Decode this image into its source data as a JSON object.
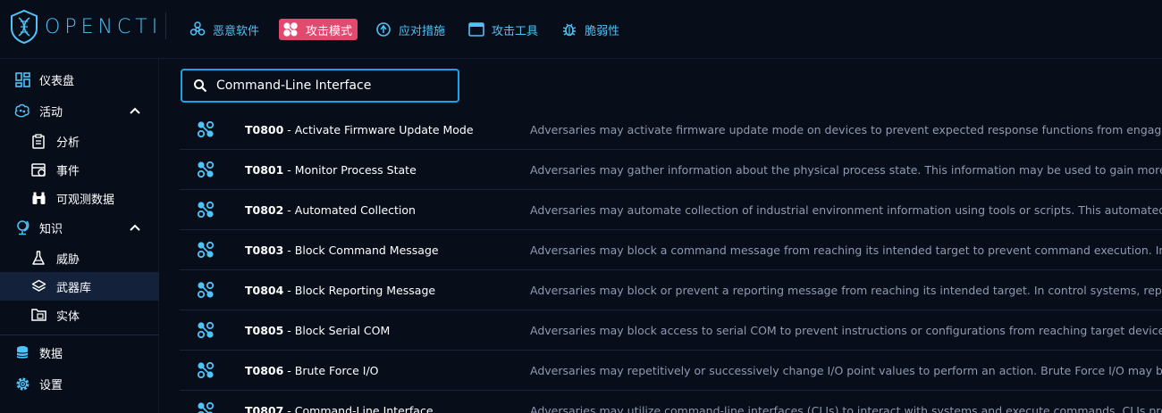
{
  "app": {
    "logo_text": "OPENCTI"
  },
  "topnav": [
    {
      "label": "恶意软件",
      "icon": "biohazard-icon",
      "active": false
    },
    {
      "label": "攻击模式",
      "icon": "attack-pattern-icon",
      "active": true
    },
    {
      "label": "应对措施",
      "icon": "course-of-action-icon",
      "active": false
    },
    {
      "label": "攻击工具",
      "icon": "tool-window-icon",
      "active": false
    },
    {
      "label": "脆弱性",
      "icon": "bug-icon",
      "active": false
    }
  ],
  "sidebar": {
    "dashboard": "仪表盘",
    "activities": "活动",
    "analysis": "分析",
    "events": "事件",
    "observations": "可观测数据",
    "knowledge": "知识",
    "threats": "威胁",
    "arsenal": "武器库",
    "entities": "实体",
    "data": "数据",
    "settings": "设置"
  },
  "search": {
    "value": "Command-Line Interface"
  },
  "rows": [
    {
      "id": "T0800",
      "name": " - Activate Firmware Update Mode",
      "desc": "Adversaries may activate firmware update mode on devices to prevent expected response functions from engaging in reac"
    },
    {
      "id": "T0801",
      "name": " - Monitor Process State",
      "desc": "Adversaries may gather information about the physical process state. This information may be used to gain more informat"
    },
    {
      "id": "T0802",
      "name": " - Automated Collection",
      "desc": "Adversaries may automate collection of industrial environment information using tools or scripts. This automated collectio"
    },
    {
      "id": "T0803",
      "name": " - Block Command Message",
      "desc": "Adversaries may block a command message from reaching its intended target to prevent command execution. In OT netw"
    },
    {
      "id": "T0804",
      "name": " - Block Reporting Message",
      "desc": "Adversaries may block or prevent a reporting message from reaching its intended target. In control systems, reporting me"
    },
    {
      "id": "T0805",
      "name": " - Block Serial COM",
      "desc": "Adversaries may block access to serial COM to prevent instructions or configurations from reaching target devices. Serial C"
    },
    {
      "id": "T0806",
      "name": " - Brute Force I/O",
      "desc": "Adversaries may repetitively or successively change I/O point values to perform an action. Brute Force I/O may be achieve"
    },
    {
      "id": "T0807",
      "name": " - Command-Line Interface",
      "desc": "Adversaries may utilize command-line interfaces (CLIs) to interact with systems and execute commands. CLIs provide a m"
    }
  ],
  "colors": {
    "accent": "#4fc3f7",
    "active_tab": "#e2496f",
    "background": "#070d19",
    "search_border": "#1ba1e5"
  }
}
